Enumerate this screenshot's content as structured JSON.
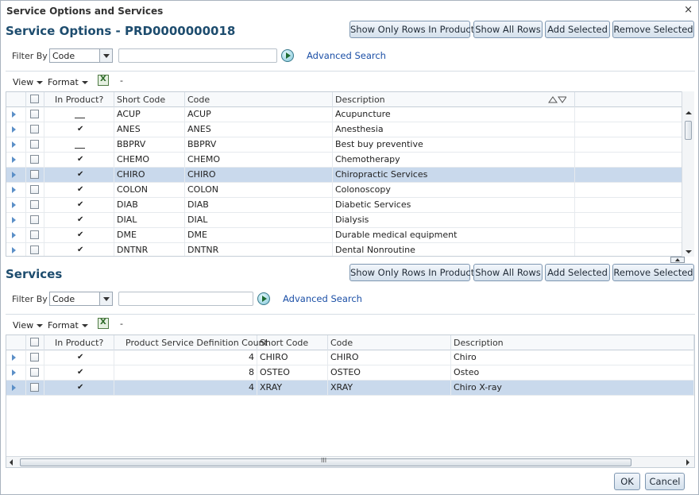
{
  "dialog": {
    "title": "Service Options and Services",
    "close_glyph": "×",
    "ok_label": "OK",
    "cancel_label": "Cancel"
  },
  "options": {
    "heading": "Service Options - PRD0000000018",
    "buttons": {
      "show_only": "Show Only Rows In Product",
      "show_all": "Show All Rows",
      "add": "Add Selected",
      "remove": "Remove Selected"
    },
    "filter_label": "Filter By",
    "filter_value": "Code",
    "filter_text": "",
    "advanced_search": "Advanced Search",
    "toolbar": {
      "view": "View",
      "format": "Format",
      "dash": "-"
    },
    "columns": [
      "In Product?",
      "Short Code",
      "Code",
      "Description"
    ],
    "rows": [
      {
        "in_product": "none",
        "short_code": "ACUP",
        "code": "ACUP",
        "description": "Acupuncture",
        "selected": false
      },
      {
        "in_product": "yes",
        "short_code": "ANES",
        "code": "ANES",
        "description": "Anesthesia",
        "selected": false
      },
      {
        "in_product": "none",
        "short_code": "BBPRV",
        "code": "BBPRV",
        "description": "Best buy preventive",
        "selected": false
      },
      {
        "in_product": "yes",
        "short_code": "CHEMO",
        "code": "CHEMO",
        "description": "Chemotherapy",
        "selected": false
      },
      {
        "in_product": "yes",
        "short_code": "CHIRO",
        "code": "CHIRO",
        "description": "Chiropractic Services",
        "selected": true
      },
      {
        "in_product": "yes",
        "short_code": "COLON",
        "code": "COLON",
        "description": "Colonoscopy",
        "selected": false
      },
      {
        "in_product": "yes",
        "short_code": "DIAB",
        "code": "DIAB",
        "description": "Diabetic Services",
        "selected": false
      },
      {
        "in_product": "yes",
        "short_code": "DIAL",
        "code": "DIAL",
        "description": "Dialysis",
        "selected": false
      },
      {
        "in_product": "yes",
        "short_code": "DME",
        "code": "DME",
        "description": "Durable medical equipment",
        "selected": false
      },
      {
        "in_product": "yes",
        "short_code": "DNTNR",
        "code": "DNTNR",
        "description": "Dental Nonroutine",
        "selected": false
      }
    ]
  },
  "services": {
    "heading": "Services",
    "buttons": {
      "show_only": "Show Only Rows In Product",
      "show_all": "Show All Rows",
      "add": "Add Selected",
      "remove": "Remove Selected"
    },
    "filter_label": "Filter By",
    "filter_value": "Code",
    "filter_text": "",
    "advanced_search": "Advanced Search",
    "toolbar": {
      "view": "View",
      "format": "Format",
      "dash": "-"
    },
    "columns": [
      "In Product?",
      "Product Service Definition Count",
      "Short Code",
      "Code",
      "Description"
    ],
    "rows": [
      {
        "in_product": "yes",
        "count": "4",
        "short_code": "CHIRO",
        "code": "CHIRO",
        "description": "Chiro",
        "selected": false
      },
      {
        "in_product": "yes",
        "count": "8",
        "short_code": "OSTEO",
        "code": "OSTEO",
        "description": "Osteo",
        "selected": false
      },
      {
        "in_product": "yes",
        "count": "4",
        "short_code": "XRAY",
        "code": "XRAY",
        "description": "Chiro X-ray",
        "selected": true
      }
    ],
    "hscroll_grip": "III"
  },
  "icons": {
    "tick_glyph": "✔"
  },
  "colors": {
    "heading": "#1d4c6e",
    "link": "#1b4fa6",
    "selected_row": "#c9d9ec"
  }
}
